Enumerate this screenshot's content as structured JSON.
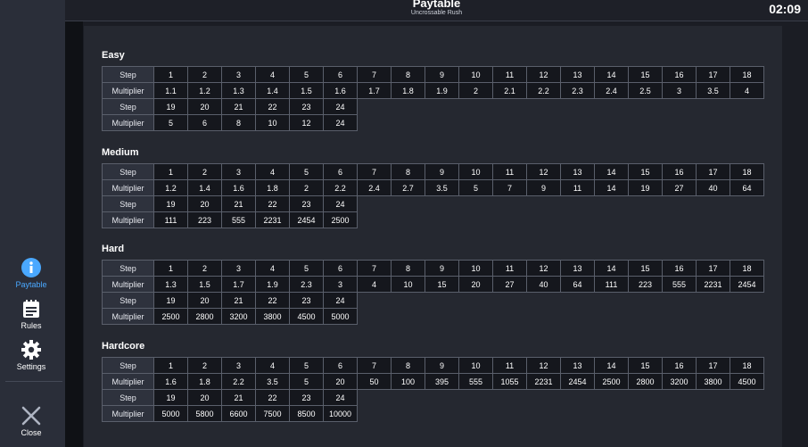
{
  "header": {
    "title": "Paytable",
    "subtitle": "Uncrossable Rush",
    "clock": "02:09"
  },
  "nav": {
    "paytable": "Paytable",
    "rules": "Rules",
    "settings": "Settings",
    "close": "Close"
  },
  "colors": {
    "accent": "#4aa8ff",
    "panel": "#252830",
    "sidebar": "#2a2e39"
  },
  "row_labels": {
    "step": "Step",
    "multiplier": "Multiplier"
  },
  "sections": [
    {
      "name": "Easy",
      "steps_a": [
        "1",
        "2",
        "3",
        "4",
        "5",
        "6",
        "7",
        "8",
        "9",
        "10",
        "11",
        "12",
        "13",
        "14",
        "15",
        "16",
        "17",
        "18"
      ],
      "mult_a": [
        "1.1",
        "1.2",
        "1.3",
        "1.4",
        "1.5",
        "1.6",
        "1.7",
        "1.8",
        "1.9",
        "2",
        "2.1",
        "2.2",
        "2.3",
        "2.4",
        "2.5",
        "3",
        "3.5",
        "4"
      ],
      "steps_b": [
        "19",
        "20",
        "21",
        "22",
        "23",
        "24"
      ],
      "mult_b": [
        "5",
        "6",
        "8",
        "10",
        "12",
        "24"
      ]
    },
    {
      "name": "Medium",
      "steps_a": [
        "1",
        "2",
        "3",
        "4",
        "5",
        "6",
        "7",
        "8",
        "9",
        "10",
        "11",
        "12",
        "13",
        "14",
        "15",
        "16",
        "17",
        "18"
      ],
      "mult_a": [
        "1.2",
        "1.4",
        "1.6",
        "1.8",
        "2",
        "2.2",
        "2.4",
        "2.7",
        "3.5",
        "5",
        "7",
        "9",
        "11",
        "14",
        "19",
        "27",
        "40",
        "64"
      ],
      "steps_b": [
        "19",
        "20",
        "21",
        "22",
        "23",
        "24"
      ],
      "mult_b": [
        "111",
        "223",
        "555",
        "2231",
        "2454",
        "2500"
      ]
    },
    {
      "name": "Hard",
      "steps_a": [
        "1",
        "2",
        "3",
        "4",
        "5",
        "6",
        "7",
        "8",
        "9",
        "10",
        "11",
        "12",
        "13",
        "14",
        "15",
        "16",
        "17",
        "18"
      ],
      "mult_a": [
        "1.3",
        "1.5",
        "1.7",
        "1.9",
        "2.3",
        "3",
        "4",
        "10",
        "15",
        "20",
        "27",
        "40",
        "64",
        "111",
        "223",
        "555",
        "2231",
        "2454"
      ],
      "steps_b": [
        "19",
        "20",
        "21",
        "22",
        "23",
        "24"
      ],
      "mult_b": [
        "2500",
        "2800",
        "3200",
        "3800",
        "4500",
        "5000"
      ]
    },
    {
      "name": "Hardcore",
      "steps_a": [
        "1",
        "2",
        "3",
        "4",
        "5",
        "6",
        "7",
        "8",
        "9",
        "10",
        "11",
        "12",
        "13",
        "14",
        "15",
        "16",
        "17",
        "18"
      ],
      "mult_a": [
        "1.6",
        "1.8",
        "2.2",
        "3.5",
        "5",
        "20",
        "50",
        "100",
        "395",
        "555",
        "1055",
        "2231",
        "2454",
        "2500",
        "2800",
        "3200",
        "3800",
        "4500"
      ],
      "steps_b": [
        "19",
        "20",
        "21",
        "22",
        "23",
        "24"
      ],
      "mult_b": [
        "5000",
        "5800",
        "6600",
        "7500",
        "8500",
        "10000"
      ]
    }
  ]
}
